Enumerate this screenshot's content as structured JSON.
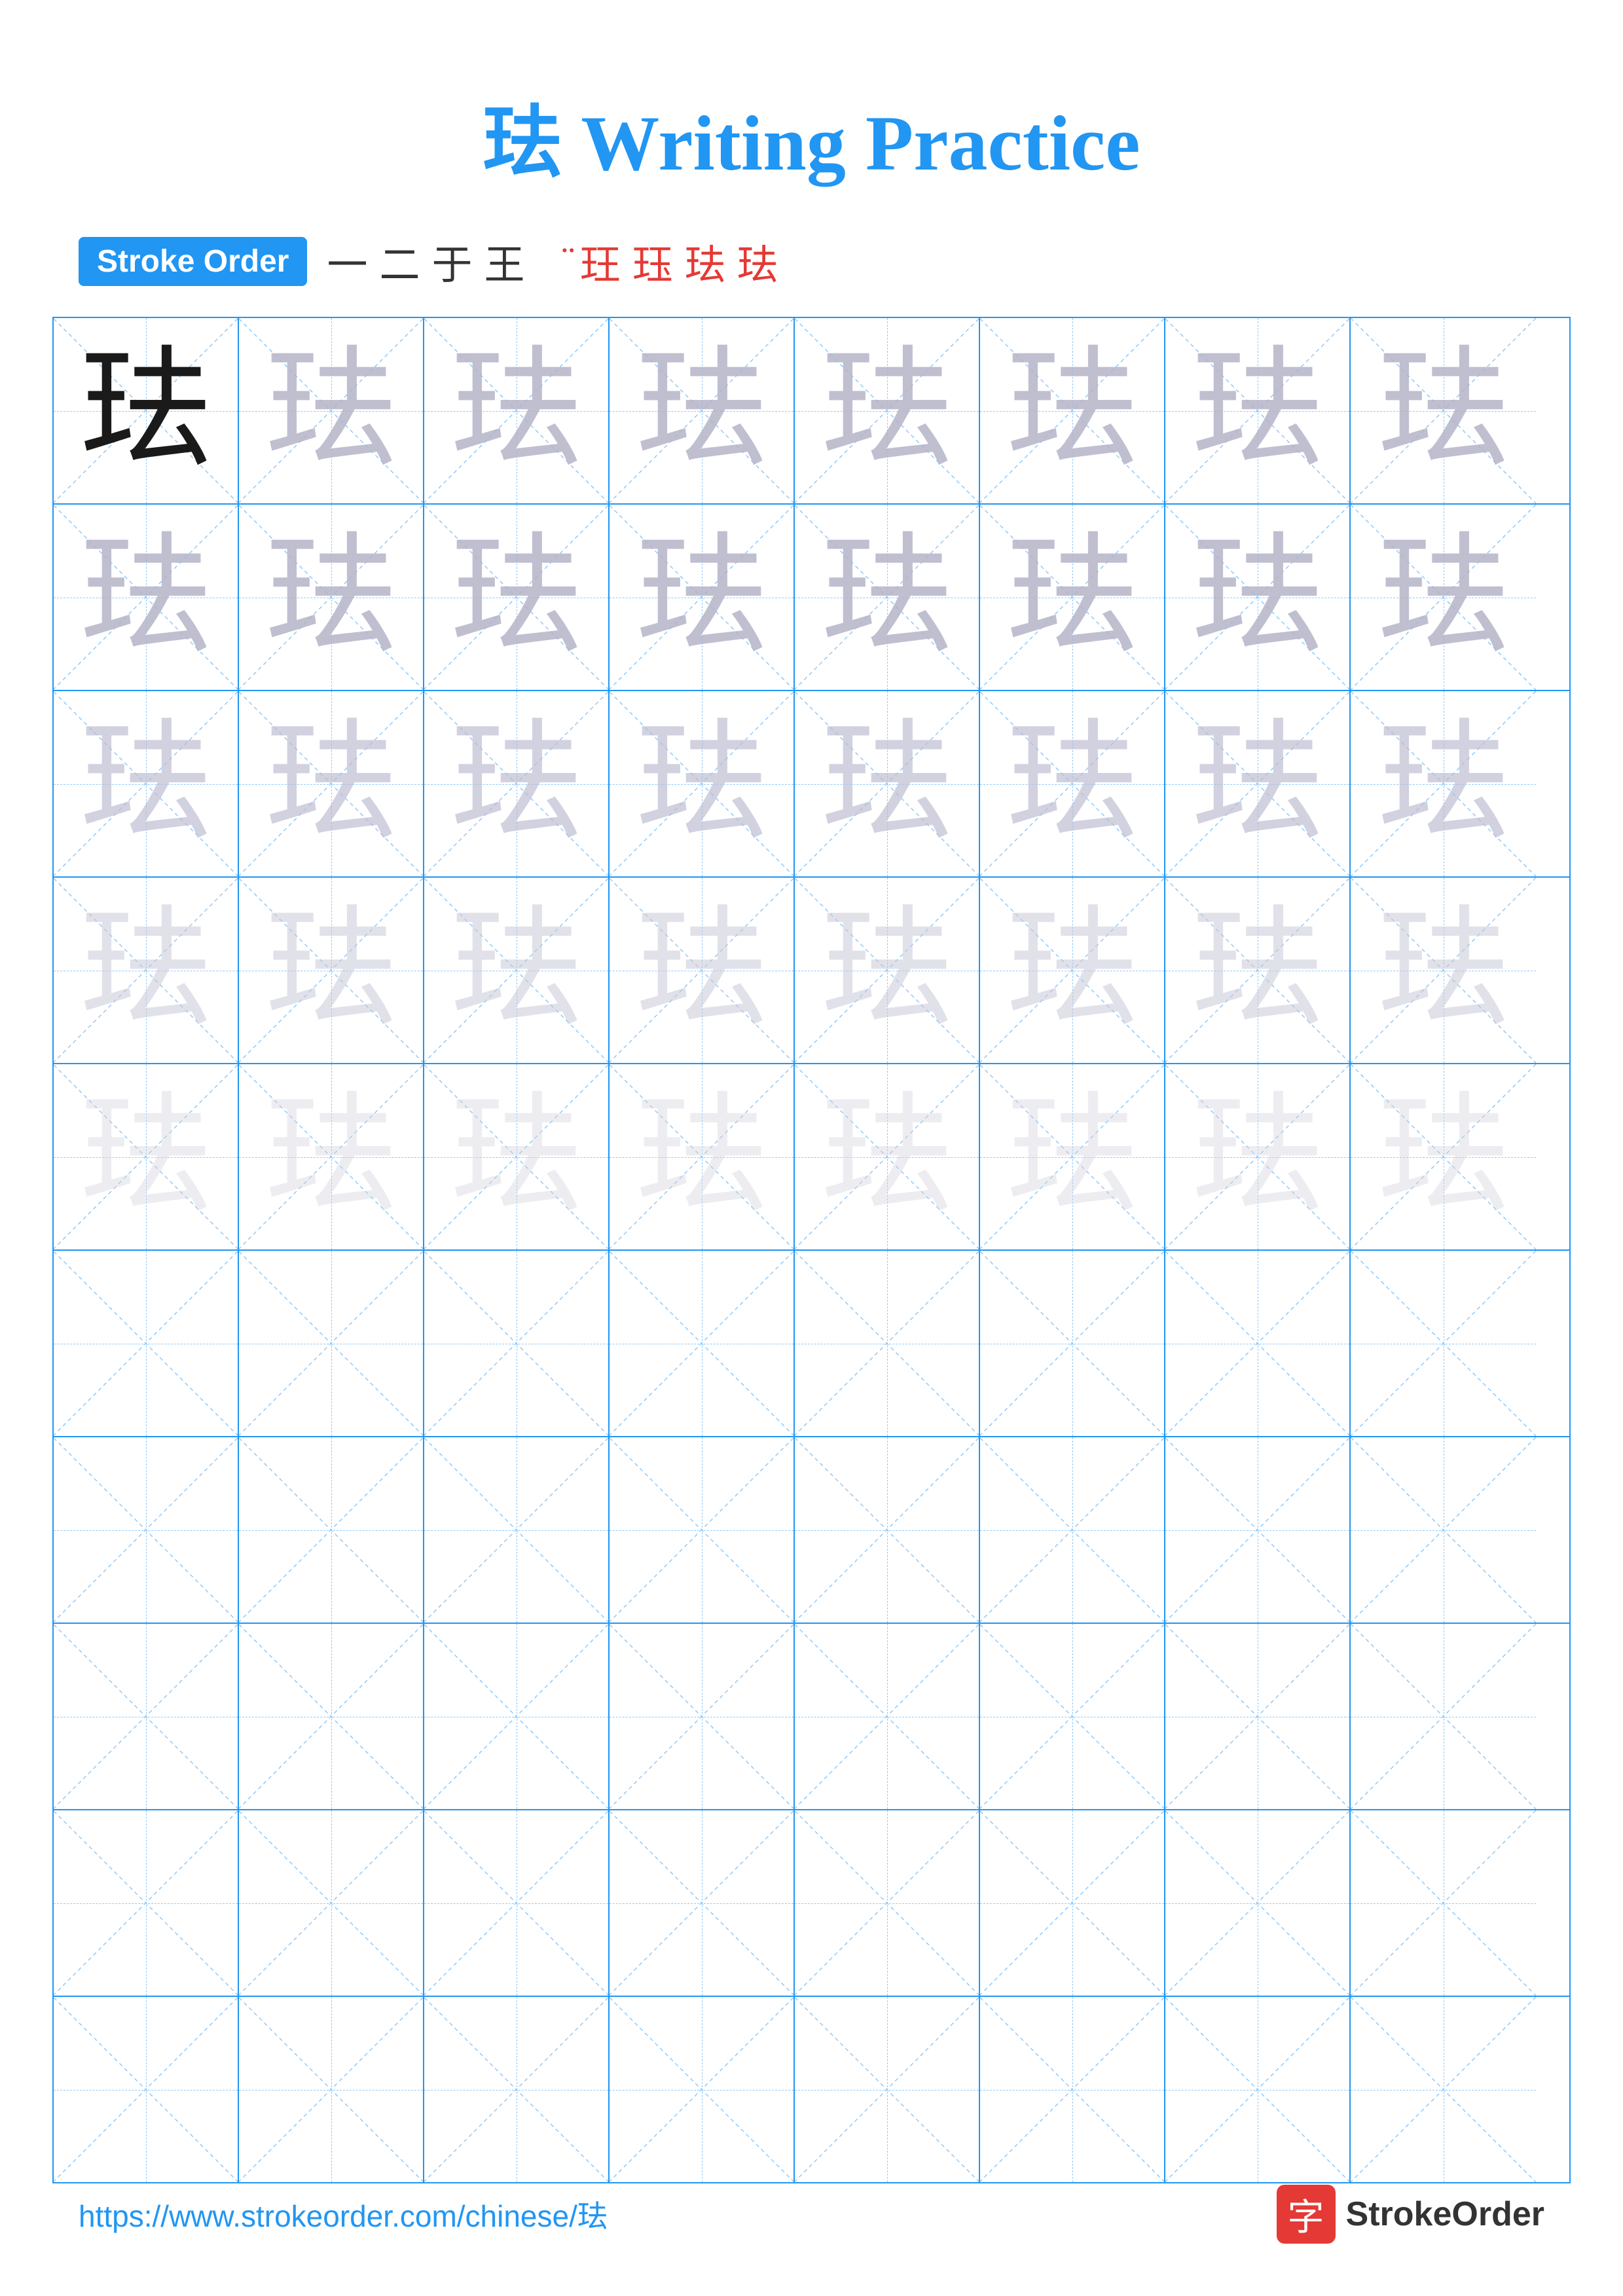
{
  "title": "珐 Writing Practice",
  "stroke_order": {
    "label": "Stroke Order",
    "strokes": [
      "一",
      "二",
      "于",
      "王",
      "王̈",
      "玨",
      "玨",
      "珐",
      "珐"
    ]
  },
  "character": "珐",
  "grid": {
    "rows": 10,
    "cols": 8
  },
  "footer": {
    "url": "https://www.strokeorder.com/chinese/珐",
    "logo_text": "StrokeOrder",
    "logo_icon": "字"
  }
}
